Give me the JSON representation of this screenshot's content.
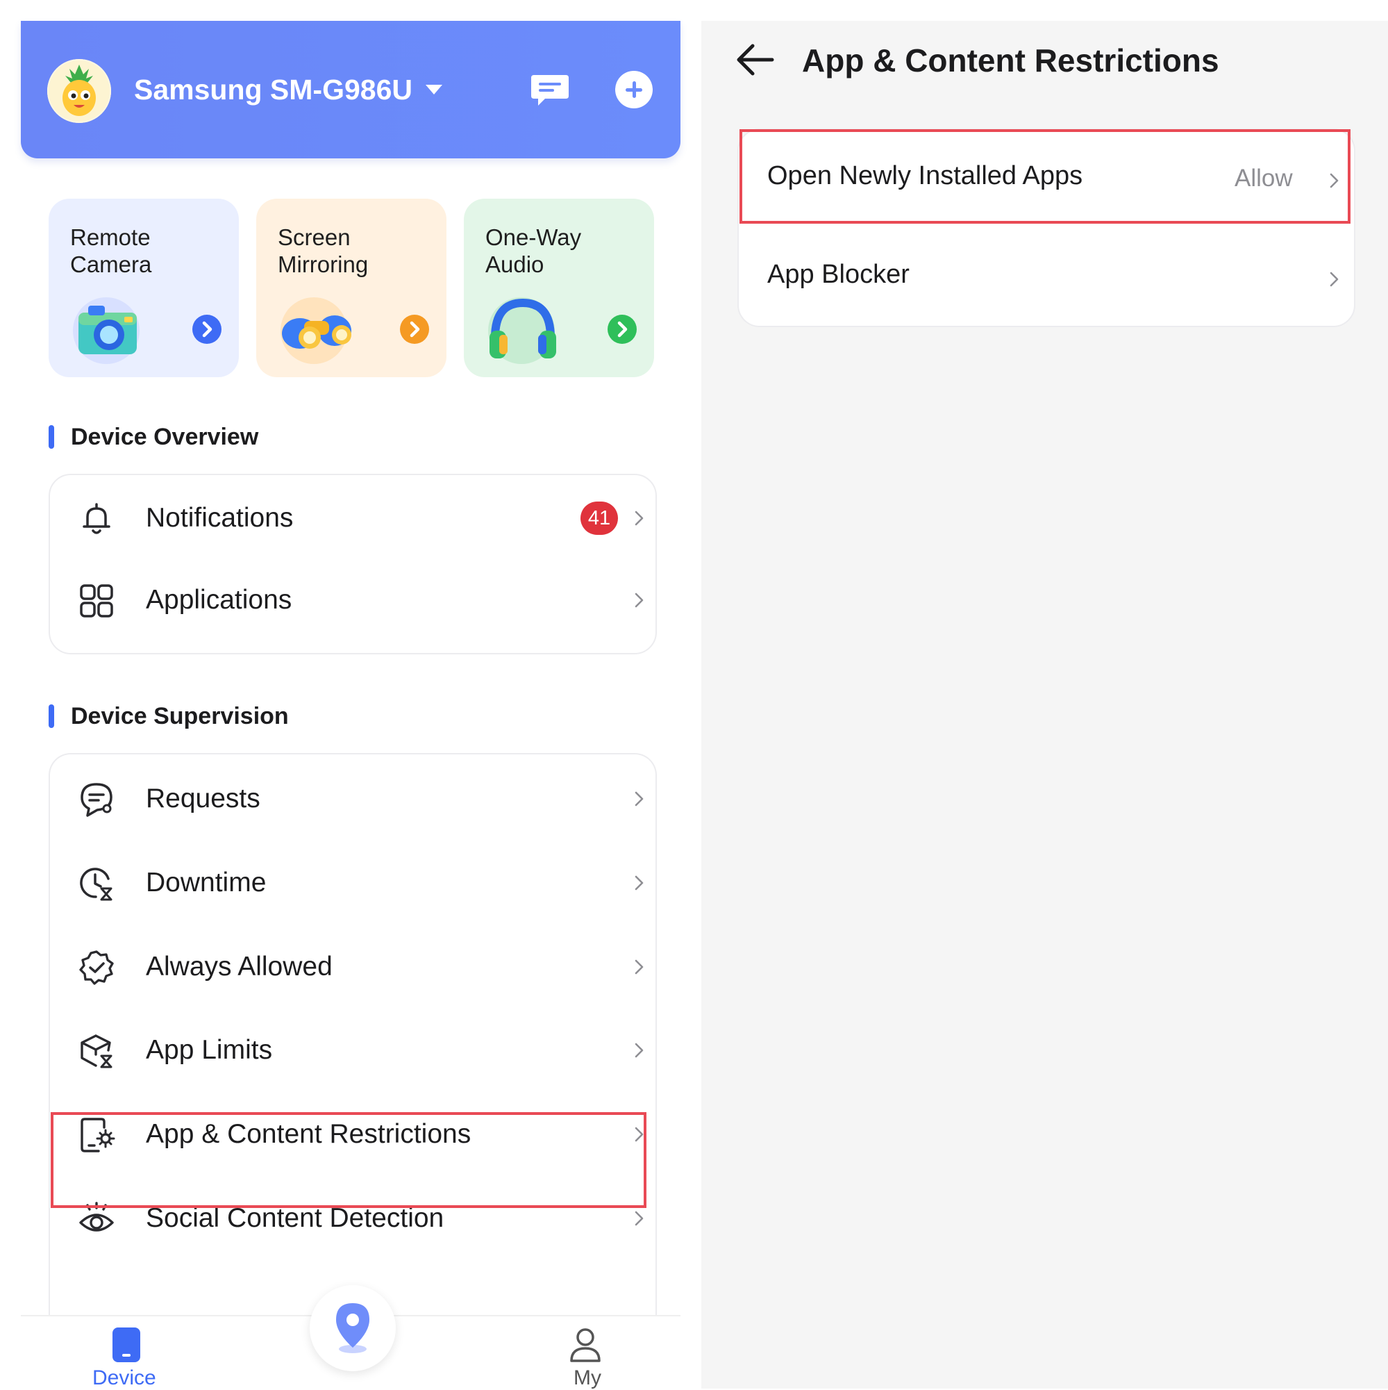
{
  "header": {
    "device_name": "Samsung SM-G986U",
    "accent_color": "#6a86f7"
  },
  "quick_cards": [
    {
      "line1": "Remote",
      "line2": "Camera",
      "icon": "camera-icon",
      "bg": "#eaefff",
      "go_color": "#3e6bf5"
    },
    {
      "line1": "Screen",
      "line2": "Mirroring",
      "icon": "binoculars-icon",
      "bg": "#fff1e0",
      "go_color": "#f59a23"
    },
    {
      "line1": "One-Way",
      "line2": "Audio",
      "icon": "headphones-icon",
      "bg": "#e3f6e8",
      "go_color": "#2fbf5a"
    }
  ],
  "sections": {
    "overview": {
      "title": "Device Overview",
      "items": [
        {
          "label": "Notifications",
          "icon": "bell-icon",
          "badge": "41"
        },
        {
          "label": "Applications",
          "icon": "apps-grid-icon"
        }
      ]
    },
    "supervision": {
      "title": "Device Supervision",
      "items": [
        {
          "label": "Requests",
          "icon": "requests-icon"
        },
        {
          "label": "Downtime",
          "icon": "downtime-clock-icon"
        },
        {
          "label": "Always Allowed",
          "icon": "verified-badge-icon"
        },
        {
          "label": "App Limits",
          "icon": "app-limits-icon"
        },
        {
          "label": "App & Content Restrictions",
          "icon": "content-restrictions-icon"
        },
        {
          "label": "Social Content Detection",
          "icon": "eye-icon"
        }
      ]
    }
  },
  "tabbar": {
    "device": "Device",
    "my": "My",
    "active_color": "#3e6bf5"
  },
  "detail": {
    "title": "App & Content Restrictions",
    "rows": [
      {
        "label": "Open Newly Installed Apps",
        "value": "Allow"
      },
      {
        "label": "App Blocker"
      }
    ]
  },
  "highlight_color": "#e94a55"
}
